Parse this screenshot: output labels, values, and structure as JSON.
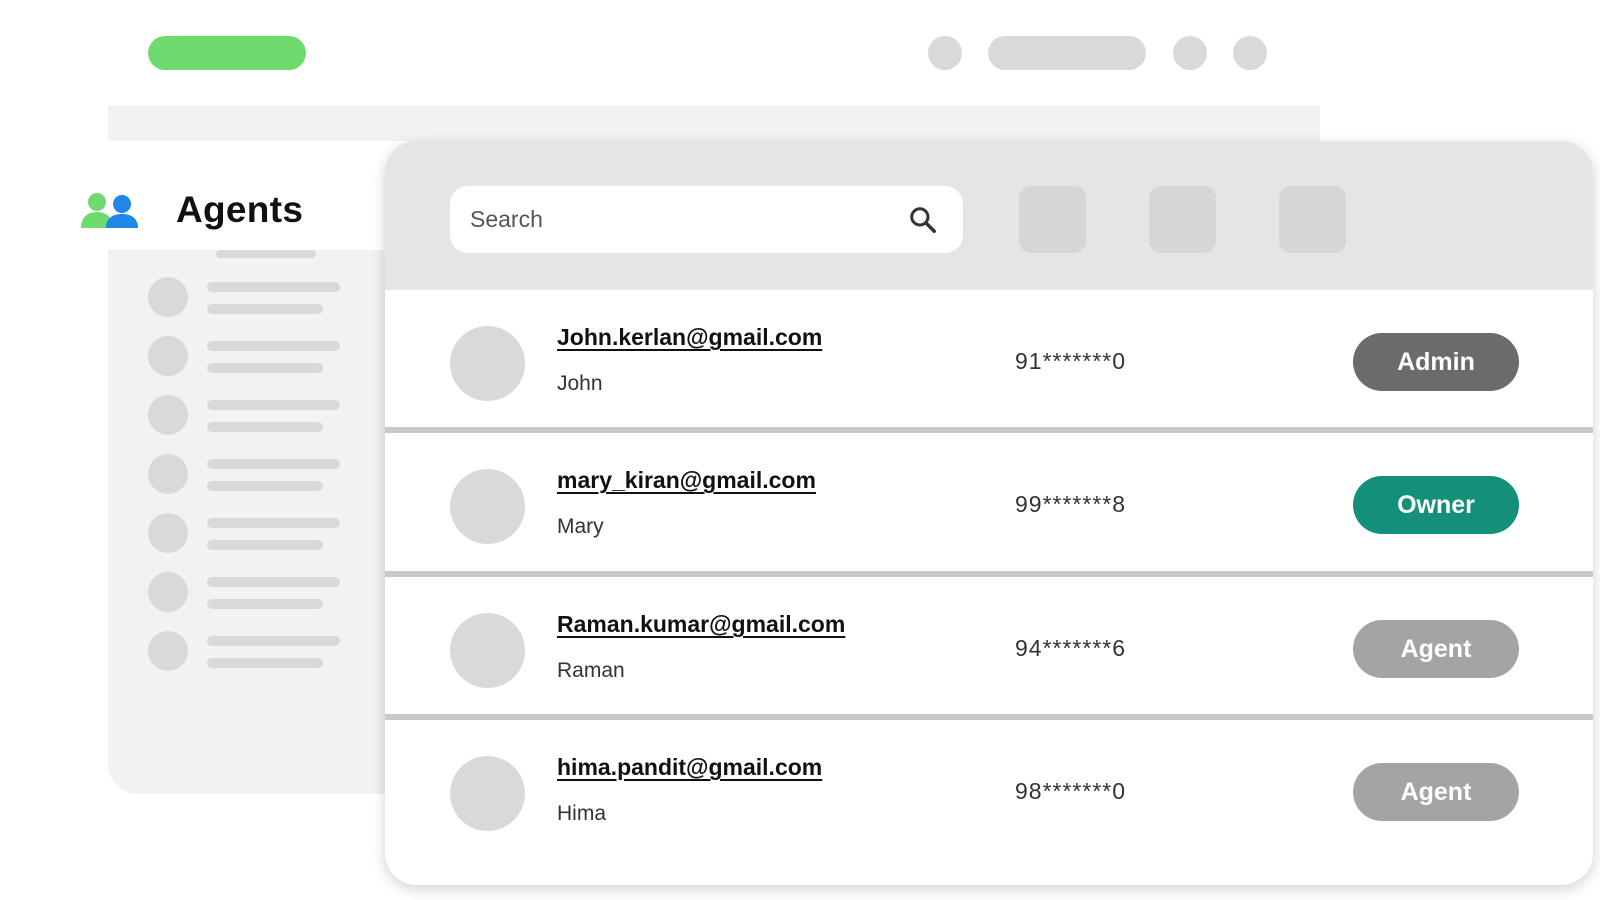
{
  "colors": {
    "accent_green": "#6fdb6f",
    "icon_blue": "#1f87e5",
    "role_admin": "#6b6b6b",
    "role_owner": "#14907a",
    "role_agent": "#a4a4a4"
  },
  "page": {
    "title": "Agents",
    "title_icon": "users-icon"
  },
  "search": {
    "placeholder": "Search",
    "icon": "search-icon"
  },
  "agents": [
    {
      "email": "John.kerlan@gmail.com",
      "name": "John",
      "phone": "91*******0",
      "role": "Admin"
    },
    {
      "email": "mary_kiran@gmail.com",
      "name": "Mary",
      "phone": "99*******8",
      "role": "Owner"
    },
    {
      "email": "Raman.kumar@gmail.com",
      "name": "Raman",
      "phone": "94*******6",
      "role": "Agent"
    },
    {
      "email": "hima.pandit@gmail.com",
      "name": "Hima",
      "phone": "98*******0",
      "role": "Agent"
    }
  ]
}
